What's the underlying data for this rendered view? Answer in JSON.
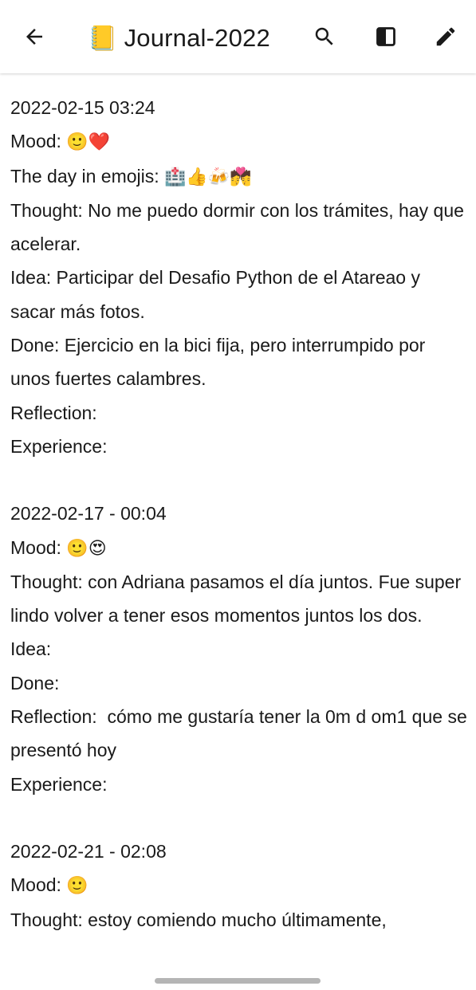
{
  "header": {
    "title_emoji": "📒",
    "title": "Journal-2022",
    "icons": [
      "back-arrow-icon",
      "search-icon",
      "side-panel-icon",
      "edit-pencil-icon"
    ]
  },
  "entries": [
    {
      "date": "2022-02-15 03:24",
      "mood_label": "Mood:",
      "mood_emojis": "🙂❤️",
      "day_label": "The day in emojis:",
      "day_emojis": "🏥👍🍻💏",
      "thought": "Thought: No me puedo dormir con los trámites, hay que acelerar.",
      "idea": "Idea: Participar del Desafio Python de el Atareao y sacar más fotos.",
      "done": "Done: Ejercicio en la bici fija, pero interrumpido por unos fuertes calambres.",
      "reflection": "Reflection:",
      "experience": "Experience:"
    },
    {
      "date": "2022-02-17 - 00:04",
      "mood_label": "Mood:",
      "mood_emojis": "🙂😍",
      "thought": "Thought: con Adriana pasamos el día juntos. Fue super lindo volver a tener esos momentos juntos los dos.",
      "idea": "Idea:",
      "done": "Done:",
      "reflection": "Reflection:  cómo me gustaría tener la 0m d om1 que se presentó hoy",
      "experience": "Experience:"
    },
    {
      "date": "2022-02-21 - 02:08",
      "mood_label": "Mood:",
      "mood_emojis": "🙂",
      "thought": "Thought: estoy comiendo mucho últimamente,"
    }
  ]
}
